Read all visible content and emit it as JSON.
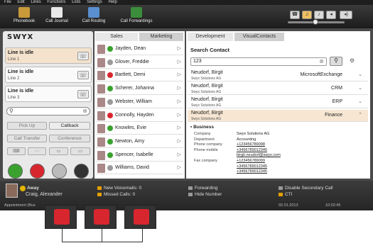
{
  "menu": [
    "File",
    "Edit",
    "Lines",
    "Functions",
    "Lists",
    "Settings",
    "Help"
  ],
  "toolbar": {
    "buttons": [
      {
        "label": "Phonebook",
        "icon": "phonebook-icon"
      },
      {
        "label": "Call Journal",
        "icon": "call-journal-icon"
      },
      {
        "label": "Call Routing",
        "icon": "call-routing-icon"
      },
      {
        "label": "Call Forwardings",
        "icon": "call-forwardings-icon"
      }
    ]
  },
  "logo": "SWYX",
  "lines": [
    {
      "title": "Line is idle",
      "sub": "Line 1"
    },
    {
      "title": "Line is idle",
      "sub": "Line 2"
    },
    {
      "title": "Line is idle",
      "sub": "Line 3"
    }
  ],
  "actions": {
    "pickup": "Pick Up",
    "callback": "Callback",
    "transfer": "Call Transfer",
    "conference": "Conference"
  },
  "contacts": {
    "tabs": [
      "Sales",
      "Marketing"
    ],
    "rows": [
      {
        "name": "Jayden, Dean",
        "status": "available"
      },
      {
        "name": "Glover, Freddie",
        "status": "offline"
      },
      {
        "name": "Bartlett, Demi",
        "status": "busy"
      },
      {
        "name": "Scherer, Johanna",
        "status": "available"
      },
      {
        "name": "Webster, William",
        "status": "offline"
      },
      {
        "name": "Connolly, Hayden",
        "status": "busy"
      },
      {
        "name": "Knowles, Evie",
        "status": "available"
      },
      {
        "name": "Newton, Amy",
        "status": "available"
      },
      {
        "name": "Spencer, Isabelle",
        "status": "available"
      },
      {
        "name": "Williams, David",
        "status": "offline"
      }
    ]
  },
  "search": {
    "tabs": [
      "Development",
      "VisualContacts"
    ],
    "title": "Search Contact",
    "query": "123",
    "results": [
      {
        "name": "Neudorf, Birgit",
        "company": "Swyx Solutions AG",
        "source": "MicrosoftExchange"
      },
      {
        "name": "Neudorf, Birgit",
        "company": "Swyx Solutions AG",
        "source": "CRM"
      },
      {
        "name": "Neudorf, Birgit",
        "company": "Swyx Solutions AG",
        "source": "ERP"
      },
      {
        "name": "Neudorf, Birgit",
        "company": "Swyx Solutions AG",
        "source": "Finance"
      }
    ],
    "business_heading": "Business",
    "details": [
      {
        "k": "Company",
        "v": "Swyx Solutions AG"
      },
      {
        "k": "Department",
        "v": "Accounting"
      },
      {
        "k": "Phone company",
        "v": "+123456789098"
      },
      {
        "k": "Phone mobile",
        "v": "+3456789012345"
      },
      {
        "k": "",
        "v": "birgit.neudorf@swyx.com"
      },
      {
        "k": "Fax company",
        "v": "+123456789099"
      },
      {
        "k": "",
        "v": "+3456789012345"
      },
      {
        "k": "",
        "v": "+3456789012345"
      }
    ]
  },
  "status": {
    "state": "Away",
    "user": "Craig, Alexander",
    "voicemails": "New Voicemails: 0",
    "missed": "Missed Calls: 0",
    "forwarding": "Forwarding",
    "hide": "Hide Number",
    "disable_secondary": "Disable Secondary Call",
    "cti": "CTI",
    "appointment": "Appointment (Bus",
    "date": "02.01.2013",
    "time": "10:02:45"
  },
  "colors": {
    "accent_red": "#d8262e",
    "available": "#3aa12f",
    "busy": "#d8262e",
    "offline": "#9a9a9a",
    "away": "#e5b400"
  }
}
